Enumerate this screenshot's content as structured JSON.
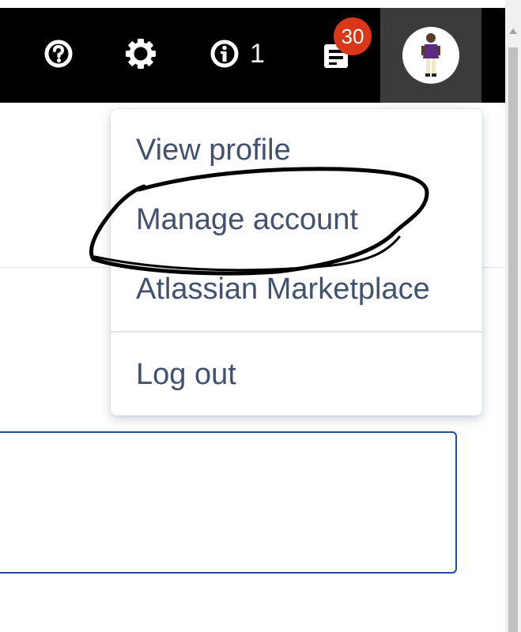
{
  "header": {
    "help_icon": "question-circle-icon",
    "settings_icon": "gear-icon",
    "info_icon": "info-circle-icon",
    "info_count": "1",
    "notifications_icon": "notification-icon",
    "notifications_badge": "30",
    "avatar": "user-avatar"
  },
  "menu": {
    "items": [
      {
        "label": "View profile"
      },
      {
        "label": "Manage account"
      },
      {
        "label": "Atlassian Marketplace"
      },
      {
        "label": "Log out"
      }
    ]
  },
  "colors": {
    "header_bg": "#000000",
    "badge_bg": "#d9361a",
    "menu_text": "#42526e",
    "input_border": "#1d4fa8"
  }
}
